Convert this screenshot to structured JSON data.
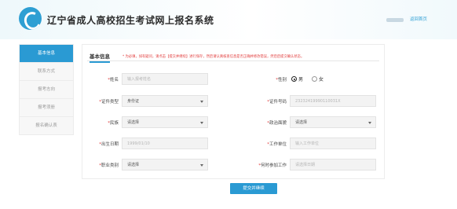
{
  "header": {
    "title": "辽宁省成人高校招生考试网上报名系统",
    "home_link": "返回首页"
  },
  "sidebar": {
    "items": [
      {
        "label": "基本信息"
      },
      {
        "label": "联系方式"
      },
      {
        "label": "报考志向"
      },
      {
        "label": "报考须册"
      },
      {
        "label": "报名确认表"
      }
    ]
  },
  "form": {
    "section_title": "基本信息",
    "note": "* 为必填，如有疑问，请点击【提交并继续】进行保存，然后请认真核查信息是否正确并修改错误，然后后提交确认状态。",
    "fields": {
      "name": {
        "label": "姓名",
        "placeholder": "输入报考姓名"
      },
      "gender": {
        "label": "性别",
        "options": [
          "男",
          "女"
        ],
        "selected": "男"
      },
      "id_type": {
        "label": "证件类型",
        "value": "身份证"
      },
      "id_number": {
        "label": "证件号码",
        "value": "23232419990110031X"
      },
      "ethnicity": {
        "label": "民族",
        "value": "请选择"
      },
      "political_status": {
        "label": "政治面貌",
        "value": "请选择"
      },
      "birth_date": {
        "label": "出生日期",
        "value": "1999/01/10"
      },
      "work_unit": {
        "label": "工作单位",
        "placeholder": "输入工作单位"
      },
      "occupation": {
        "label": "职业类别",
        "value": "请选择"
      },
      "work_start": {
        "label": "何时参加工作",
        "placeholder": "请选择日期"
      }
    },
    "submit_label": "提交并继续"
  }
}
